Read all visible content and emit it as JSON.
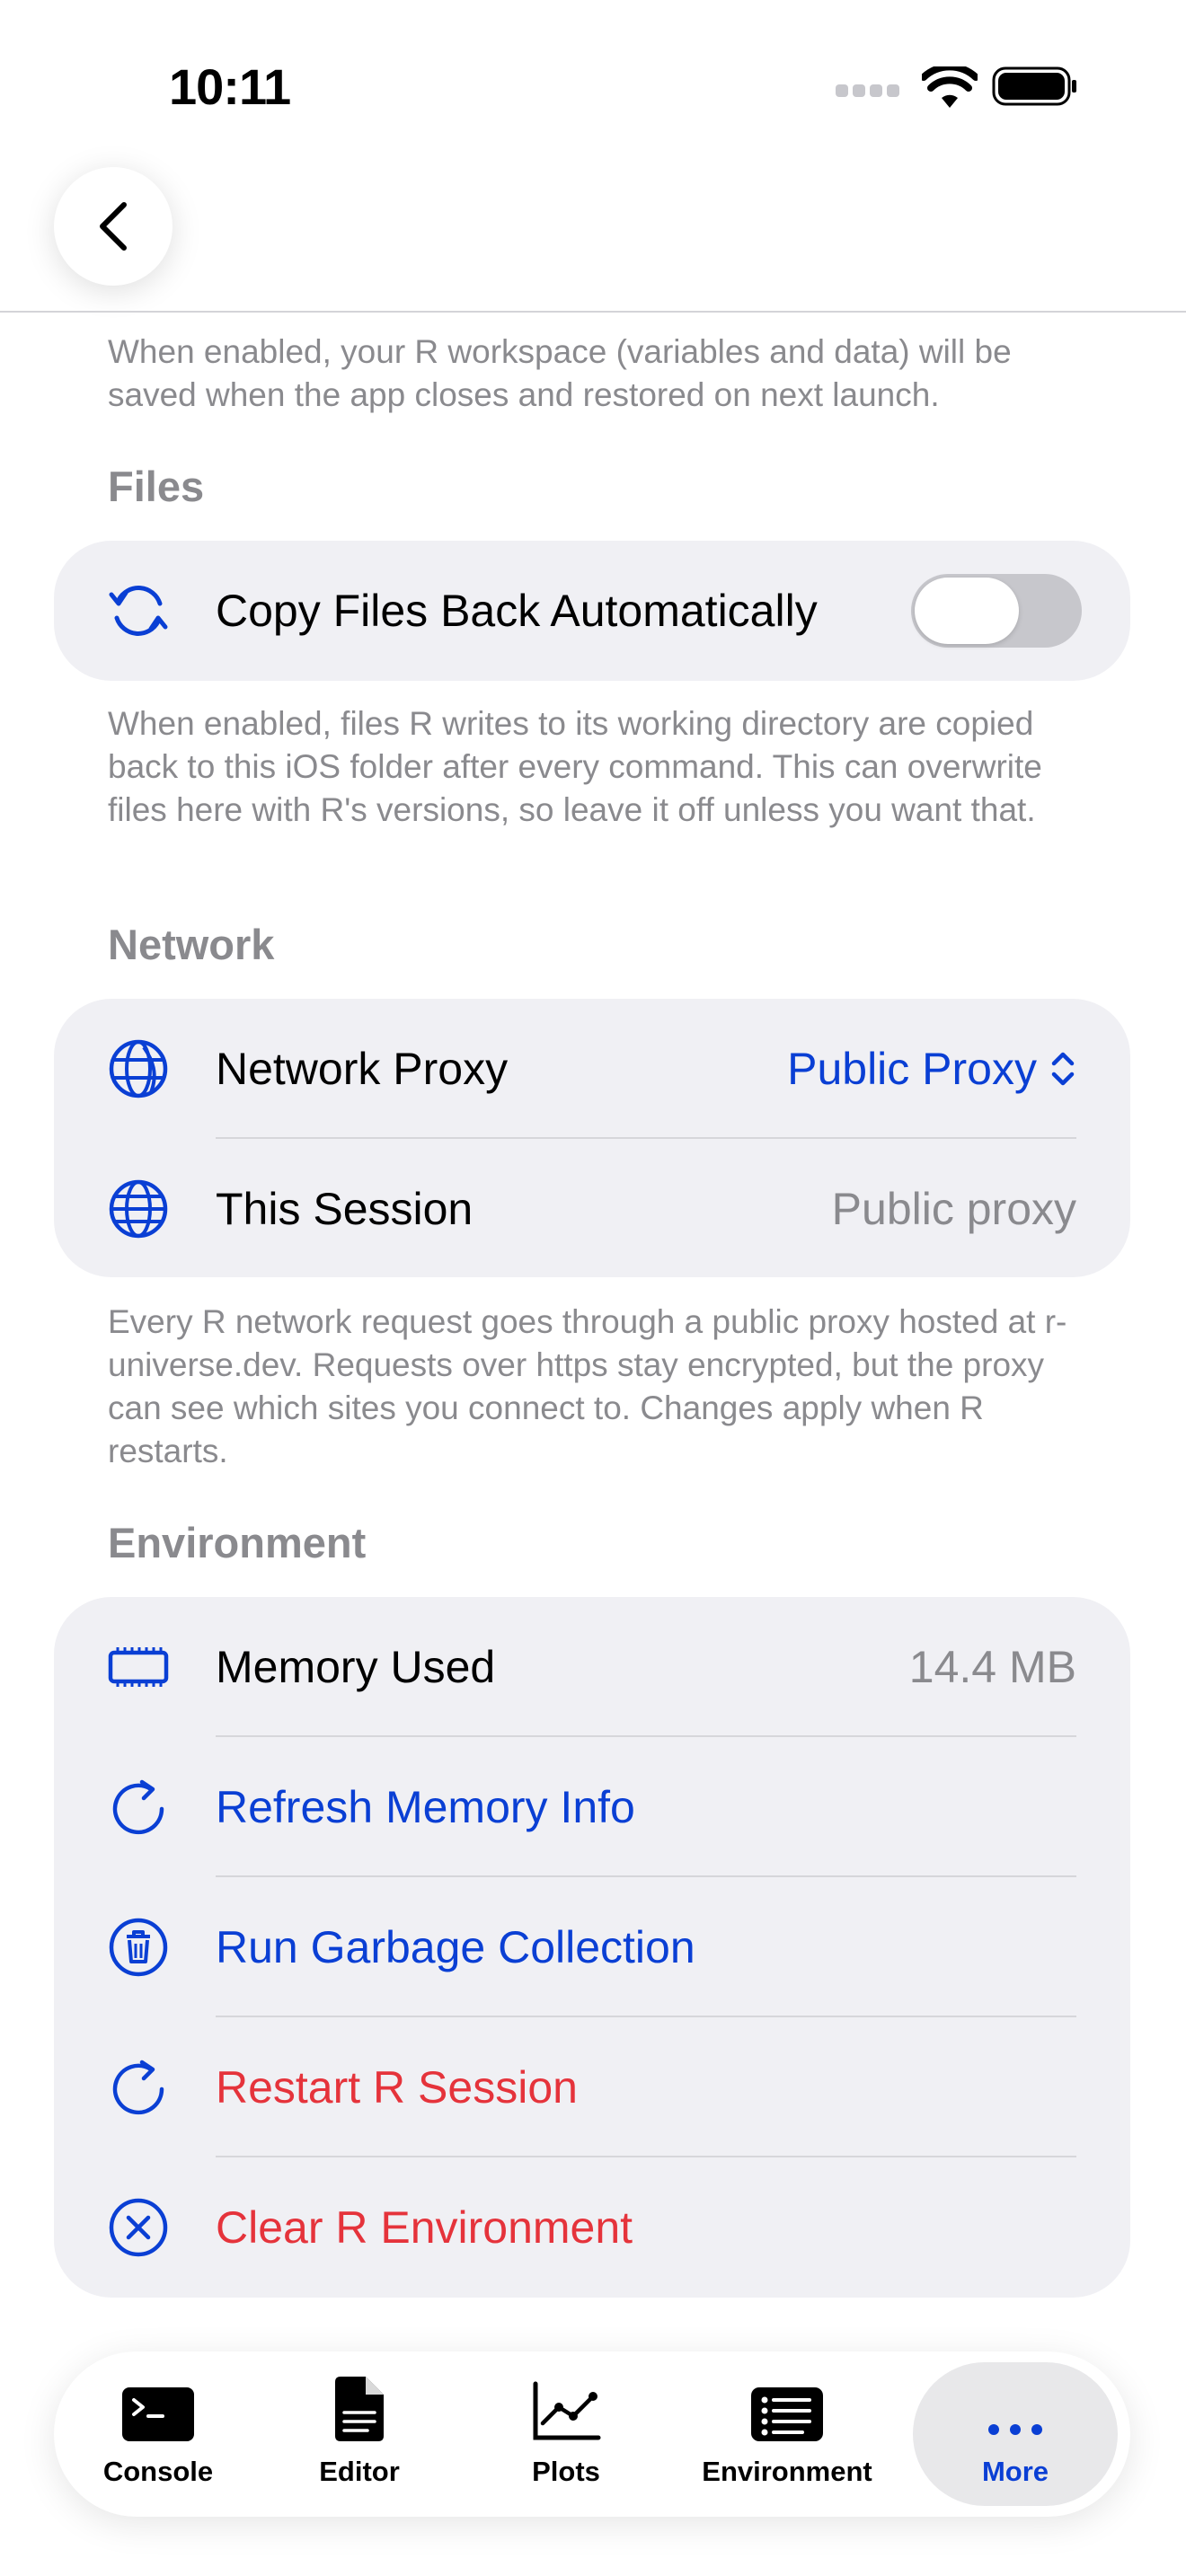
{
  "status_bar": {
    "time": "10:11"
  },
  "workspace_footer": "When enabled, your R workspace (variables and data) will be saved when the app closes and restored on next launch.",
  "files": {
    "header": "Files",
    "copy_back_label": "Copy Files Back Automatically",
    "copy_back_enabled": false,
    "footer": "When enabled, files R writes to its working directory are copied back to this iOS folder after every command. This can overwrite files here with R's versions, so leave it off unless you want that."
  },
  "network": {
    "header": "Network",
    "proxy_label": "Network Proxy",
    "proxy_value": "Public Proxy",
    "session_label": "This Session",
    "session_value": "Public proxy",
    "footer": "Every R network request goes through a public proxy hosted at r-universe.dev. Requests over https stay encrypted, but the proxy can see which sites you connect to. Changes apply when R restarts."
  },
  "environment": {
    "header": "Environment",
    "memory_label": "Memory Used",
    "memory_value": "14.4 MB",
    "refresh_label": "Refresh Memory Info",
    "gc_label": "Run Garbage Collection",
    "restart_label": "Restart R Session",
    "clear_label": "Clear R Environment"
  },
  "tab_bar": {
    "tabs": [
      {
        "label": "Console",
        "icon": "terminal-icon"
      },
      {
        "label": "Editor",
        "icon": "document-icon"
      },
      {
        "label": "Plots",
        "icon": "chart-icon"
      },
      {
        "label": "Environment",
        "icon": "list-icon"
      },
      {
        "label": "More",
        "icon": "ellipsis-icon"
      }
    ],
    "active": "More"
  },
  "colors": {
    "accent": "#0a3fd4",
    "danger": "#e5333b",
    "secondary_text": "#8a8a8e",
    "group_background": "#f0f0f4"
  }
}
